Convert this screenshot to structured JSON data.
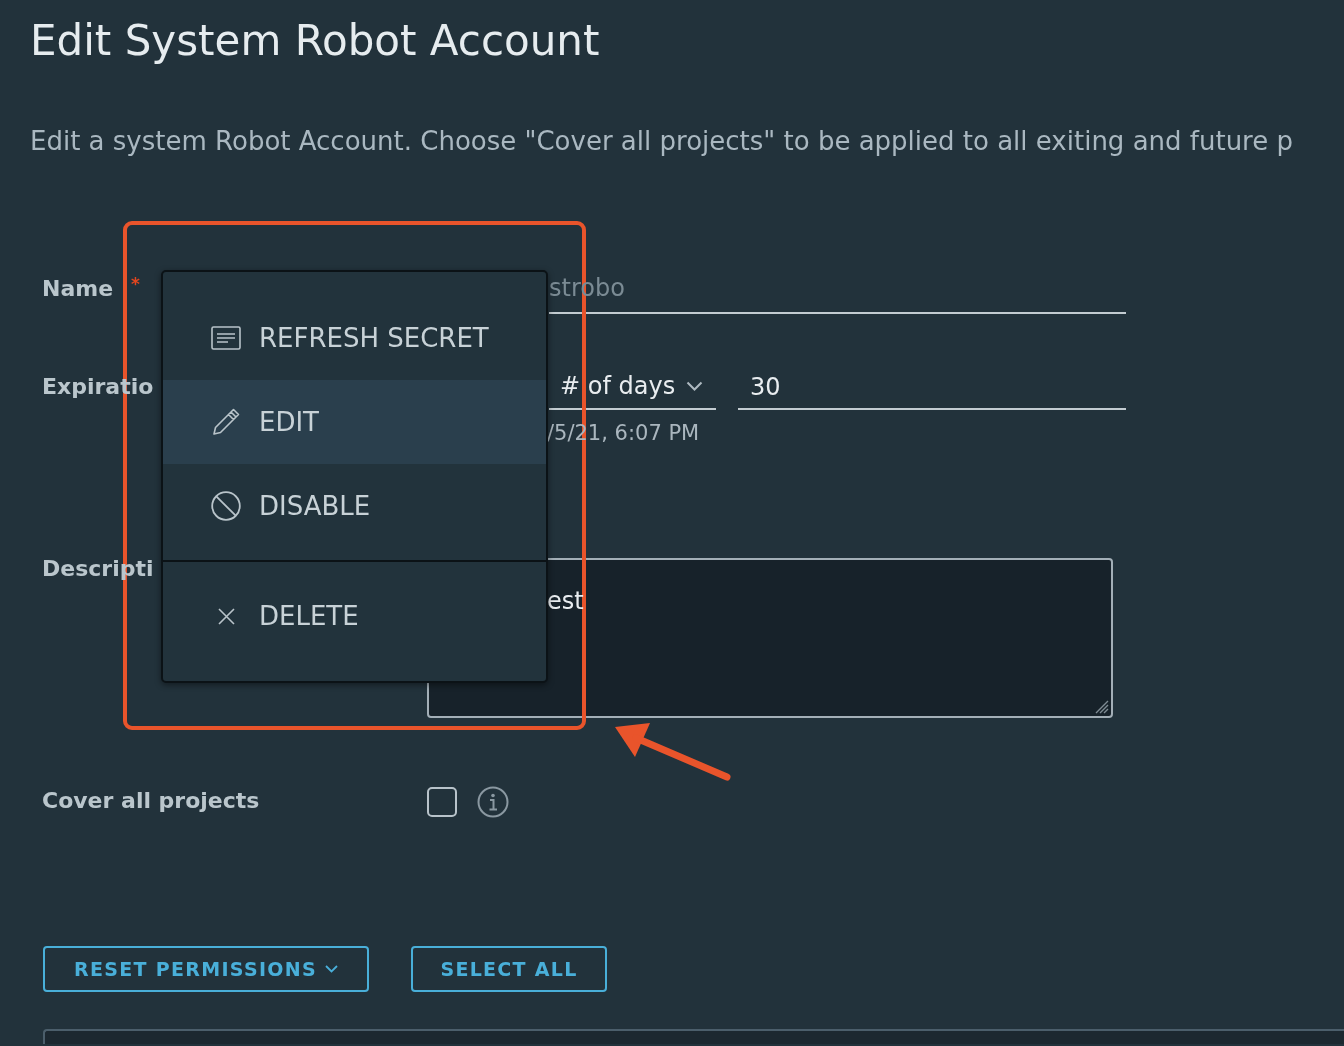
{
  "page": {
    "title": "Edit System Robot Account",
    "description": "Edit a system Robot Account. Choose \"Cover all projects\" to be applied to all exiting and future p"
  },
  "form": {
    "fields": [
      {
        "kind": "text",
        "label": "Name",
        "required_mark": "*",
        "value": "strobo",
        "disabled": true
      },
      {
        "kind": "expiration",
        "label": "Expiratio",
        "select": "# of days",
        "value": "30",
        "note": "/5/21, 6:07 PM"
      },
      {
        "kind": "textarea",
        "label": "Descripti",
        "value": "est"
      },
      {
        "kind": "checkbox",
        "label": "Cover all projects",
        "checked": false,
        "info": true
      }
    ]
  },
  "buttons": [
    {
      "label": "RESET PERMISSIONS",
      "dropdown": true
    },
    {
      "label": "SELECT ALL",
      "dropdown": false
    }
  ],
  "context_menu": {
    "groups": [
      {
        "items": [
          {
            "kind": "secret",
            "label": "REFRESH SECRET",
            "selected": false
          },
          {
            "kind": "edit",
            "label": "EDIT",
            "selected": true
          },
          {
            "kind": "disable",
            "label": "DISABLE",
            "selected": false
          }
        ]
      },
      {
        "items": [
          {
            "kind": "delete",
            "label": "DELETE",
            "selected": false
          }
        ]
      }
    ]
  },
  "annotation": {
    "highlight_frame": true,
    "arrow": true
  }
}
